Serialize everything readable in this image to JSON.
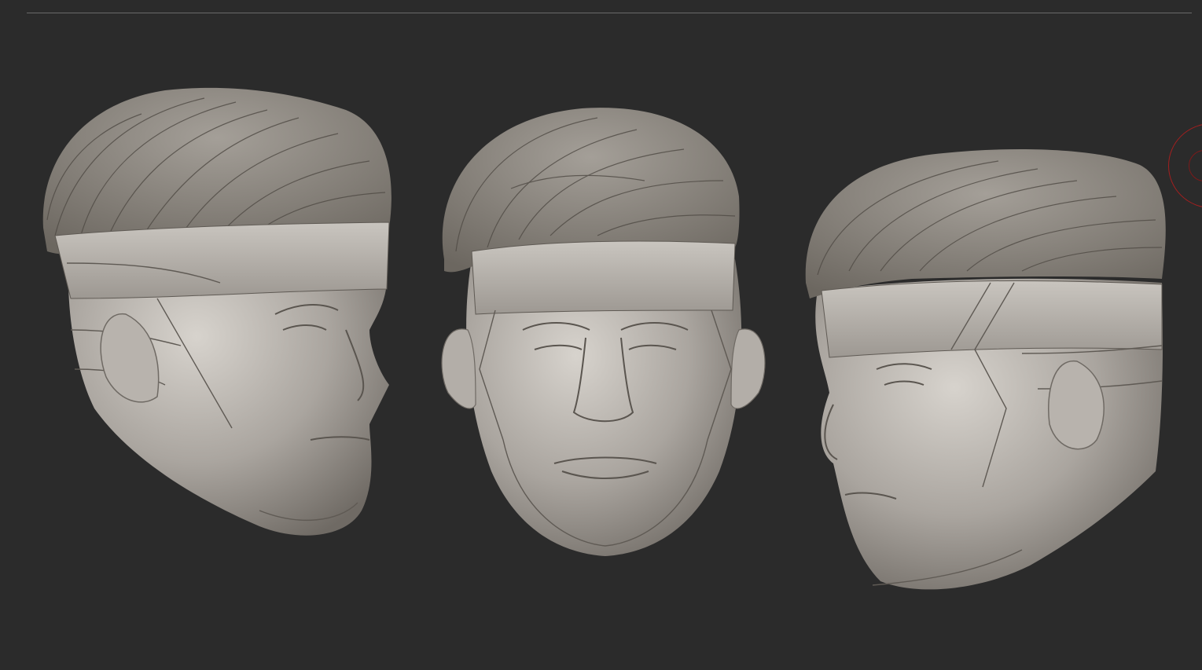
{
  "viewport": {
    "background": "#2b2b2b",
    "border_color": "#6a6a6a"
  },
  "model": {
    "material_base": "#a8a39d",
    "material_light": "#d7d3cd",
    "material_shadow": "#6f6a64",
    "views": [
      "three-quarter-right",
      "front",
      "profile-left"
    ]
  },
  "gizmo": {
    "color": "#a31f1f",
    "icon": "navigation-gizmo-icon"
  }
}
